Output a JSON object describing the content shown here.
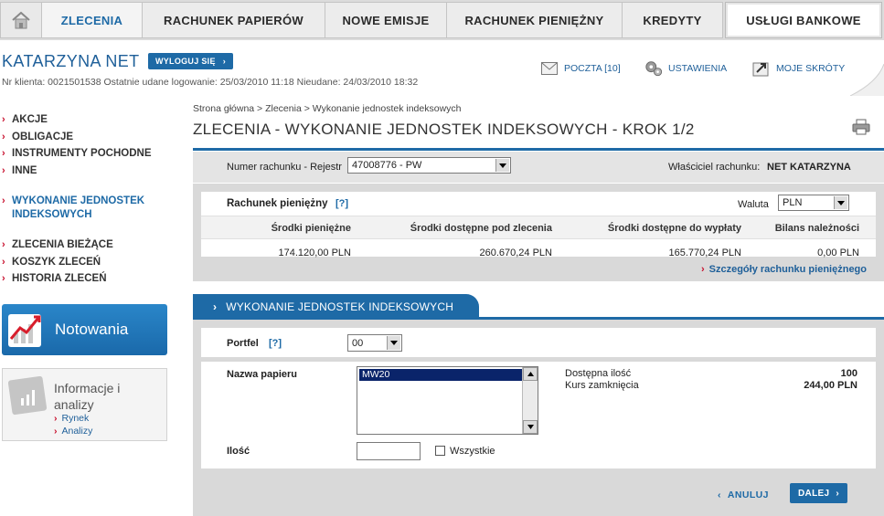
{
  "nav": {
    "tabs": [
      {
        "label": "ZLECENIA",
        "active": true
      },
      {
        "label": "RACHUNEK PAPIERÓW"
      },
      {
        "label": "NOWE EMISJE"
      },
      {
        "label": "RACHUNEK PIENIĘŻNY"
      },
      {
        "label": "KREDYTY"
      },
      {
        "label": "USŁUGI BANKOWE"
      }
    ]
  },
  "user": {
    "name": "KATARZYNA NET",
    "logout_label": "WYLOGUJ SIĘ",
    "client_info": "Nr klienta: 0021501538  Ostatnie udane logowanie:  25/03/2010 11:18  Nieudane: 24/03/2010 18:32"
  },
  "header_links": {
    "mail": "POCZTA [10]",
    "settings": "USTAWIENIA",
    "shortcuts": "MOJE SKRÓTY"
  },
  "sidebar": {
    "group1": [
      "AKCJE",
      "OBLIGACJE",
      "INSTRUMENTY POCHODNE",
      "INNE"
    ],
    "active_item": "WYKONANIE JEDNOSTEK INDEKSOWYCH",
    "group3": [
      "ZLECENIA BIEŻĄCE",
      "KOSZYK ZLECEŃ",
      "HISTORIA ZLECEŃ"
    ],
    "notowania": "Notowania",
    "info": {
      "title": "Informacje i analizy",
      "links": [
        "Rynek",
        "Analizy"
      ]
    }
  },
  "main": {
    "breadcrumb": "Strona główna > Zlecenia > Wykonanie jednostek indeksowych",
    "title": "ZLECENIA - WYKONANIE JEDNOSTEK INDEKSOWYCH - KROK 1/2",
    "account": {
      "label": "Numer rachunku - Rejestr",
      "value": "47008776 - PW",
      "owner_label": "Właściciel rachunku:",
      "owner_value": "NET KATARZYNA"
    },
    "funds": {
      "title": "Rachunek pieniężny",
      "help": "[?]",
      "currency_label": "Waluta",
      "currency_value": "PLN",
      "headers": [
        "Środki pieniężne",
        "Środki dostępne pod zlecenia",
        "Środki dostępne do wypłaty",
        "Bilans należności"
      ],
      "values": [
        "174.120,00 PLN",
        "260.670,24 PLN",
        "165.770,24 PLN",
        "0,00 PLN"
      ],
      "details_link": "Szczegóły rachunku pieniężnego"
    },
    "form": {
      "tab_label": "WYKONANIE JEDNOSTEK INDEKSOWYCH",
      "portfolio_label": "Portfel",
      "portfolio_help": "[?]",
      "portfolio_value": "00",
      "paper_label": "Nazwa papieru",
      "paper_options": [
        "MW20"
      ],
      "available_label": "Dostępna ilość",
      "available_value": "100",
      "close_label": "Kurs zamknięcia",
      "close_value": "244,00 PLN",
      "qty_label": "Ilość",
      "qty_value": "",
      "all_label": "Wszystkie",
      "cancel_label": "ANULUJ",
      "next_label": "DALEJ"
    }
  }
}
